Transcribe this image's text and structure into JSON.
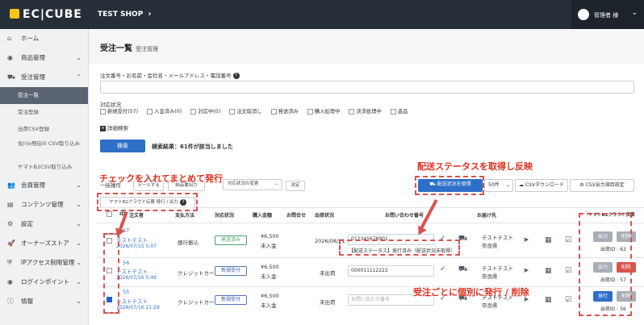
{
  "header": {
    "logo": "EC|CUBE",
    "shop_name": "TEST SHOP",
    "shop_chevron": "›",
    "user_name": "管理者 様",
    "user_caret": "⌄"
  },
  "sidebar": {
    "items": [
      {
        "label": "ホーム",
        "icon": "home-icon",
        "glyph": "⌂"
      },
      {
        "label": "商品管理",
        "icon": "cube-icon",
        "glyph": "◉",
        "chev": "⌄"
      },
      {
        "label": "受注管理",
        "icon": "cart-icon",
        "glyph": "⛟",
        "chev": "⌃"
      }
    ],
    "sub": [
      "受注一覧",
      "受注登録",
      "出荷CSV登録",
      "佐川e飛伝III CSV取り込み",
      "ヤマトB2CSV取り込み"
    ],
    "items2": [
      {
        "label": "会員管理",
        "glyph": "👥",
        "chev": "⌄"
      },
      {
        "label": "コンテンツ管理",
        "glyph": "▤",
        "chev": "⌄"
      },
      {
        "label": "設定",
        "glyph": "⚙",
        "chev": "⌄"
      },
      {
        "label": "オーナーズストア",
        "glyph": "🚀",
        "chev": "⌄"
      },
      {
        "label": "IPアクセス制限管理",
        "glyph": "⛨",
        "chev": "⌄"
      },
      {
        "label": "ログインポイント",
        "glyph": "◉",
        "chev": "⌄"
      },
      {
        "label": "情報",
        "glyph": "ⓘ",
        "chev": "⌄"
      }
    ]
  },
  "page": {
    "title": "受注一覧",
    "subtitle": "受注管理"
  },
  "search": {
    "label": "注文番号・お名前・会社名・メールアドレス・電話番号",
    "status_label": "対応状況",
    "statuses": [
      {
        "label": "新規受付(57)",
        "checked": false
      },
      {
        "label": "入金済み(0)",
        "checked": false
      },
      {
        "label": "対応中(0)",
        "checked": false
      },
      {
        "label": "注文取消し",
        "checked": false
      },
      {
        "label": "発送済み",
        "checked": false
      },
      {
        "label": "購入処理中",
        "checked": false
      },
      {
        "label": "決済処理中",
        "checked": false
      },
      {
        "label": "返品",
        "checked": false
      }
    ],
    "advanced": "詳細検索",
    "button": "検索",
    "result": "検索結果：61件が該当しました"
  },
  "bulk": {
    "label": "一括操作",
    "mail": "メールする",
    "slip": "納品書出力",
    "status_change": "対応状況の変更",
    "decide": "決定",
    "yamato_btn": "ヤマトB2クラウド伝票 発行 / 出力",
    "delivery_status_btn": "配送状況を取得",
    "per_page": "50件",
    "csv_download": "CSVダウンロード",
    "csv_settings": "CSV出力項目設定"
  },
  "table": {
    "headers": [
      "ID",
      "注文者",
      "支払方法",
      "対応状況",
      "購入金額",
      "お問合せ",
      "出荷状況",
      "お問い合わせ番号",
      "お届け先",
      "ヤマトB2クラウド伝票"
    ],
    "rows": [
      {
        "id": "67",
        "name": "テストテスト",
        "date": "2026/07/15 5:07",
        "payment": "銀行振込",
        "status": "発送済み",
        "amount": "¥6,500",
        "paid": "未入金",
        "ship_date": "2026/08/21",
        "tracking": "012345678901",
        "tracking_status": "【配送ステータス】発行済み（配送状況未取得）",
        "recipient": "テストテスト",
        "pref": "奈良県",
        "b1": "出力",
        "b2": "削除",
        "issue_id": "出荷ID : 63",
        "checked": false
      },
      {
        "id": "56",
        "name": "テストテスト",
        "date": "2026/07/16 5:49",
        "payment": "クレジットカード",
        "status": "新規受付",
        "amount": "¥6,500",
        "paid": "未入金",
        "ship_date": "未出荷",
        "tracking": "000011112222",
        "tracking_status": "",
        "recipient": "テストテスト",
        "pref": "奈良県",
        "b1": "出力",
        "b2": "削除",
        "issue_id": "出荷ID : 57",
        "checked": false
      },
      {
        "id": "55",
        "name": "テストテスト",
        "date": "2026/07/16 21:29",
        "payment": "クレジットカード",
        "status": "新規受付",
        "amount": "¥6,500",
        "paid": "未入金",
        "ship_date": "未出荷",
        "tracking": "お問い合わせ番号",
        "tracking_status": "",
        "recipient": "テストテスト",
        "pref": "奈良県",
        "b1": "発行",
        "b2": "削除",
        "issue_id": "出荷ID : 56",
        "checked": true
      }
    ]
  },
  "annotations": {
    "a1": "チェックを入れてまとめて発行",
    "a2": "配送ステータスを取得し反映",
    "a3": "受注ごとに個別に発行 / 削除"
  },
  "colors": {
    "accent": "#2e6fc8",
    "danger": "#d9534f",
    "annotation": "#e0301e",
    "topbar": "#262e38"
  }
}
